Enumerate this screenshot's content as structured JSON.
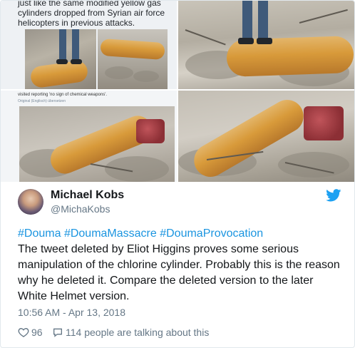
{
  "images": {
    "top_left_caption": "just like the same modified yellow gas cylinders dropped from Syrian air force helicopters in previous attacks.",
    "bottom_left_note": "visited reporting 'no sign of chemical weapons'.",
    "bottom_left_note2": "Original (Englisch) übersetzen"
  },
  "tweet": {
    "author_name": "Michael Kobs",
    "author_handle": "@MichaKobs",
    "hashtags": [
      "#Douma",
      "#DoumaMassacre",
      "#DoumaProvocation"
    ],
    "body": "The tweet deleted by Eliot Higgins proves some serious manipulation of the chlorine cylinder. Probably this is the reason why he deleted it. Compare the deleted version to the later White Helmet version.",
    "timestamp": "10:56 AM - Apr 13, 2018",
    "like_count": "96",
    "talking_label": "114 people are talking about this"
  },
  "colors": {
    "link": "#1b95e0",
    "twitter_bird": "#1da1f2",
    "muted": "#657786",
    "text": "#14171a"
  },
  "icons": {
    "brand": "twitter-bird-icon",
    "like": "heart-icon",
    "reply": "speech-bubble-icon"
  }
}
